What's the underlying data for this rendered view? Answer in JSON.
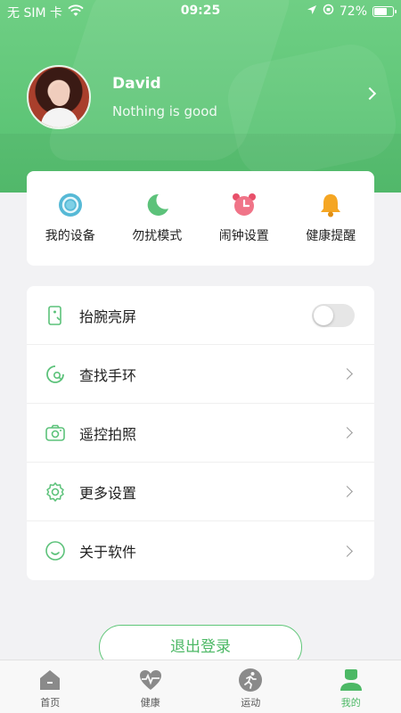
{
  "status_bar": {
    "carrier": "无 SIM 卡",
    "time": "09:25",
    "battery_percent": "72%",
    "battery_level": 0.72
  },
  "profile": {
    "name": "David",
    "motto": "Nothing is good"
  },
  "quick_actions": [
    {
      "label": "我的设备",
      "icon": "device-ring-icon"
    },
    {
      "label": "勿扰模式",
      "icon": "moon-icon"
    },
    {
      "label": "闹钟设置",
      "icon": "alarm-clock-icon"
    },
    {
      "label": "健康提醒",
      "icon": "bell-icon"
    }
  ],
  "settings": [
    {
      "label": "抬腕亮屏",
      "icon": "wrist-raise-icon",
      "control": "toggle",
      "toggle_on": false
    },
    {
      "label": "查找手环",
      "icon": "find-band-icon",
      "control": "chevron"
    },
    {
      "label": "遥控拍照",
      "icon": "camera-icon",
      "control": "chevron"
    },
    {
      "label": "更多设置",
      "icon": "gear-icon",
      "control": "chevron"
    },
    {
      "label": "关于软件",
      "icon": "smiley-icon",
      "control": "chevron"
    }
  ],
  "logout_label": "退出登录",
  "tabs": [
    {
      "label": "首页",
      "icon": "home-icon",
      "active": false
    },
    {
      "label": "健康",
      "icon": "heart-pulse-icon",
      "active": false
    },
    {
      "label": "运动",
      "icon": "running-icon",
      "active": false
    },
    {
      "label": "我的",
      "icon": "profile-icon",
      "active": true
    }
  ],
  "colors": {
    "accent": "#5fc678",
    "accent_text": "#4cb865",
    "background": "#f2f2f4"
  }
}
